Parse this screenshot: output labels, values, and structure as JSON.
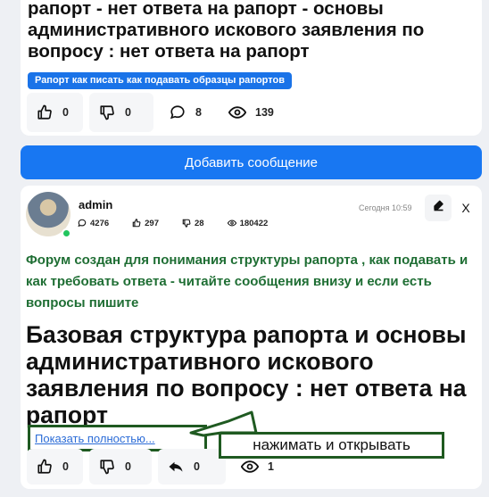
{
  "prev_post": {
    "title": "рапорт - нет ответа на рапорт - основы административного искового заявления по вопросу : нет ответа на рапорт",
    "tag": "Рапорт как писать как подавать образцы рапортов",
    "likes": "0",
    "dislikes": "0",
    "comments": "8",
    "views": "139"
  },
  "add_message_label": "Добавить сообщение",
  "post": {
    "author": "admin",
    "timestamp": "Сегодня 10:59",
    "close_label": "X",
    "author_stats": {
      "messages": "4276",
      "likes": "297",
      "dislikes": "28",
      "views": "180422"
    },
    "intro": "Форум создан для понимания структуры рапорта , как подавать и как требовать ответа - читайте сообщения внизу и если есть вопросы пишите",
    "title": "Базовая структура рапорта и основы административного искового заявления по вопросу : нет ответа на рапорт",
    "show_more": "Показать полностью...",
    "likes": "0",
    "dislikes": "0",
    "replies": "0",
    "views": "1"
  },
  "annotation": "нажимать и открывать",
  "colors": {
    "accent": "#1877f2",
    "tag": "#1a73e8",
    "green_text": "#1f6e34",
    "annotation_border": "#1f5a21",
    "online": "#22c55e"
  }
}
